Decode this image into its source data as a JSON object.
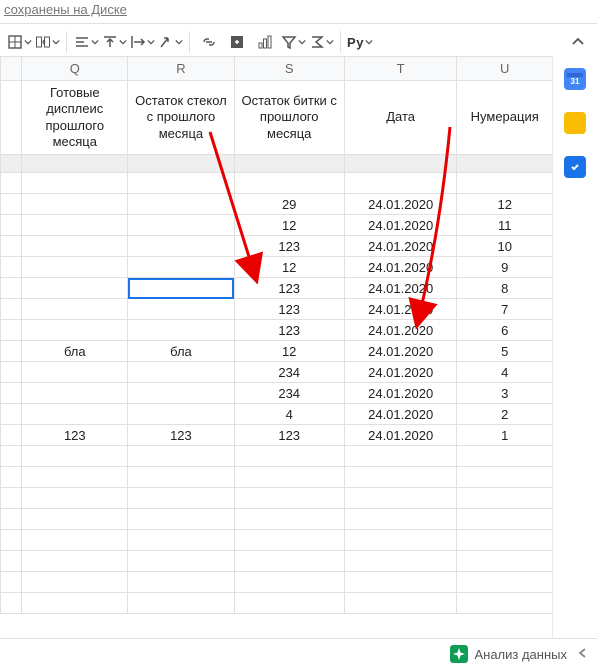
{
  "top_link": "сохранены на Диске",
  "toolbar": {
    "py_label": "Py"
  },
  "columns": [
    "Q",
    "R",
    "S",
    "T",
    "U"
  ],
  "headers": {
    "Q": "Готовые дисплеис прошлого месяца",
    "R": "Остаток стекол с прошлого месяца",
    "S": "Остаток битки с прошлого месяца",
    "T": "Дата",
    "U": "Нумерация"
  },
  "rows": [
    {
      "Q": "",
      "R": "",
      "S": "",
      "T": "",
      "U": ""
    },
    {
      "Q": "",
      "R": "",
      "S": "29",
      "T": "24.01.2020",
      "U": "12"
    },
    {
      "Q": "",
      "R": "",
      "S": "12",
      "T": "24.01.2020",
      "U": "11"
    },
    {
      "Q": "",
      "R": "",
      "S": "123",
      "T": "24.01.2020",
      "U": "10"
    },
    {
      "Q": "",
      "R": "",
      "S": "12",
      "T": "24.01.2020",
      "U": "9"
    },
    {
      "Q": "",
      "R": "",
      "S": "123",
      "T": "24.01.2020",
      "U": "8"
    },
    {
      "Q": "",
      "R": "",
      "S": "123",
      "T": "24.01.2020",
      "U": "7"
    },
    {
      "Q": "",
      "R": "",
      "S": "123",
      "T": "24.01.2020",
      "U": "6"
    },
    {
      "Q": "бла",
      "R": "бла",
      "S": "12",
      "T": "24.01.2020",
      "U": "5"
    },
    {
      "Q": "",
      "R": "",
      "S": "234",
      "T": "24.01.2020",
      "U": "4"
    },
    {
      "Q": "",
      "R": "",
      "S": "234",
      "T": "24.01.2020",
      "U": "3"
    },
    {
      "Q": "",
      "R": "",
      "S": "4",
      "T": "24.01.2020",
      "U": "2"
    },
    {
      "Q": "123",
      "R": "123",
      "S": "123",
      "T": "24.01.2020",
      "U": "1"
    }
  ],
  "selected_cell": {
    "row": 5,
    "col": "R"
  },
  "bottom": {
    "explore_label": "Анализ данных"
  }
}
